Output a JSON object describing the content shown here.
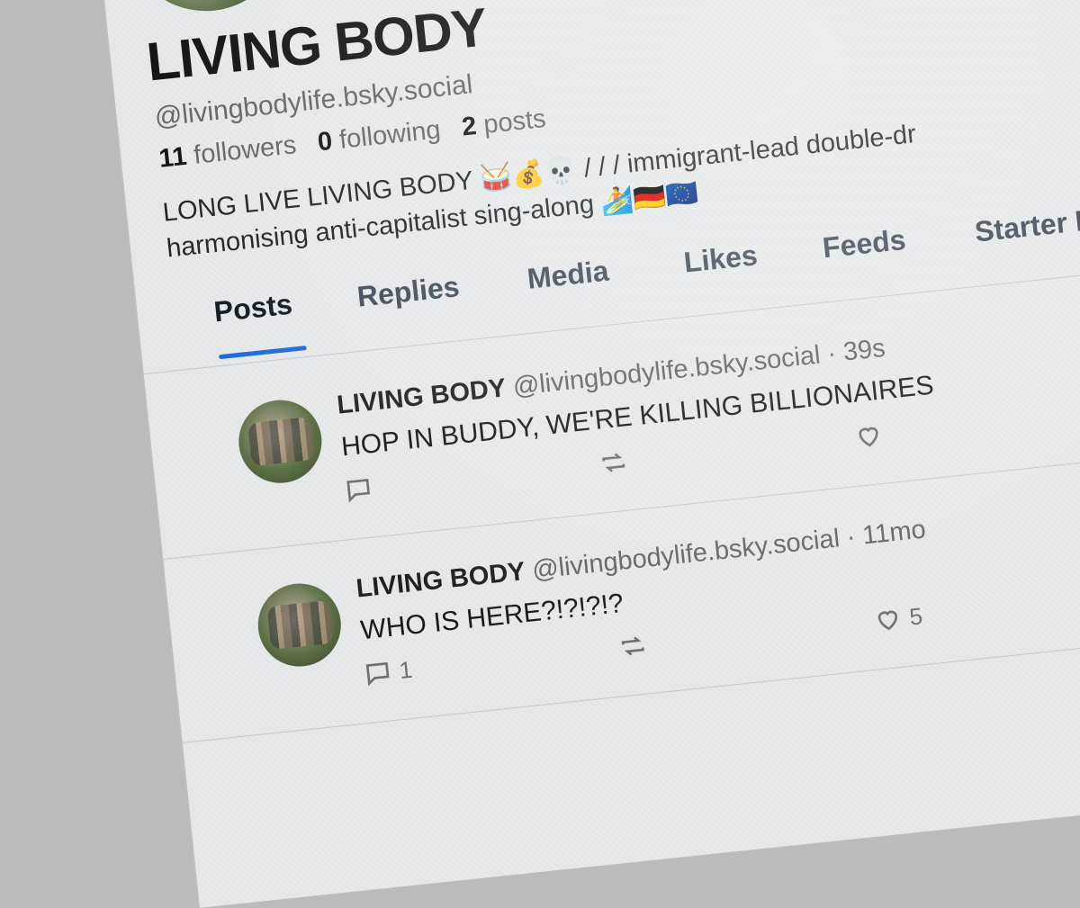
{
  "profile": {
    "display_name": "LIVING BODY",
    "handle": "@livingbodylife.bsky.social",
    "followers_count": "11",
    "followers_label": "followers",
    "following_count": "0",
    "following_label": "following",
    "posts_count": "2",
    "posts_label": "posts",
    "bio_line1": "LONG LIVE LIVING BODY 🥁💰💀 / / / immigrant-lead double-dr",
    "bio_line2": "harmonising anti-capitalist sing-along 🏄🇩🇪🇪🇺"
  },
  "tabs": [
    {
      "label": "Posts",
      "active": true
    },
    {
      "label": "Replies"
    },
    {
      "label": "Media"
    },
    {
      "label": "Likes"
    },
    {
      "label": "Feeds"
    },
    {
      "label": "Starter P"
    }
  ],
  "posts": [
    {
      "author": "LIVING BODY",
      "handle": "@livingbodylife.bsky.social",
      "sep": "·",
      "time": "39s",
      "text": "HOP IN BUDDY, WE'RE KILLING BILLIONAIRES",
      "reply_count": "",
      "like_count": ""
    },
    {
      "author": "LIVING BODY",
      "handle": "@livingbodylife.bsky.social",
      "sep": "·",
      "time": "11mo",
      "text": "WHO IS HERE?!?!?!?",
      "reply_count": "1",
      "like_count": "5"
    }
  ],
  "colors": {
    "accent": "#1e6ad8",
    "background": "#e6e9ea",
    "text": "#111111",
    "muted": "#5f6569"
  }
}
